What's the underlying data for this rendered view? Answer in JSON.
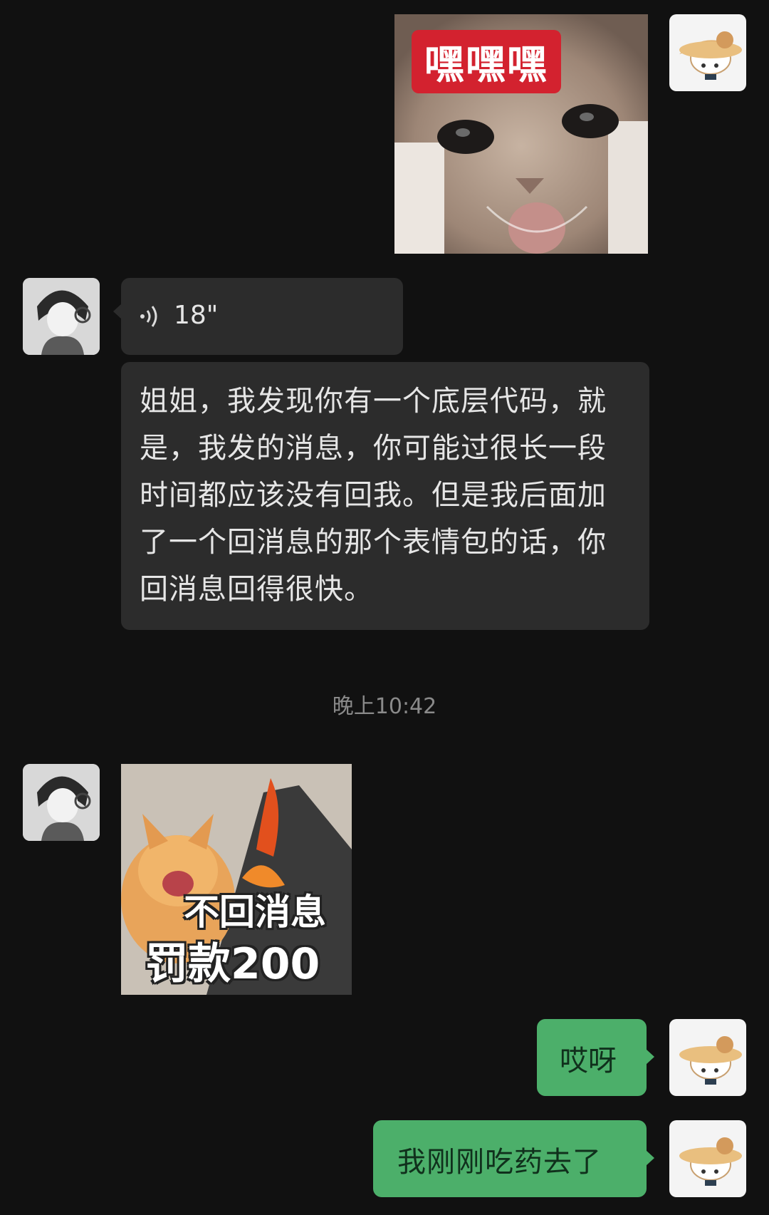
{
  "messages": {
    "sticker_hehehe": {
      "caption": "嘿嘿嘿",
      "colors": {
        "caption_bg": "#d3222f"
      }
    },
    "voice": {
      "icon": "voice-wave-icon",
      "duration": "18\""
    },
    "long_text": "姐姐，我发现你有一个底层代码，就是，我发的消息，你可能过很长一段时间都应该没有回我。但是我后面加了一个回消息的那个表情包的话，你回消息回得很快。",
    "timestamp": "晚上10:42",
    "sticker_fine": {
      "line1": "不回消息",
      "line2": "罚款200"
    },
    "reply_1": "哎呀",
    "reply_2": "我刚刚吃药去了"
  },
  "colors": {
    "background": "#111111",
    "incoming_bubble": "#2c2c2c",
    "outgoing_bubble": "#4caf6a"
  }
}
